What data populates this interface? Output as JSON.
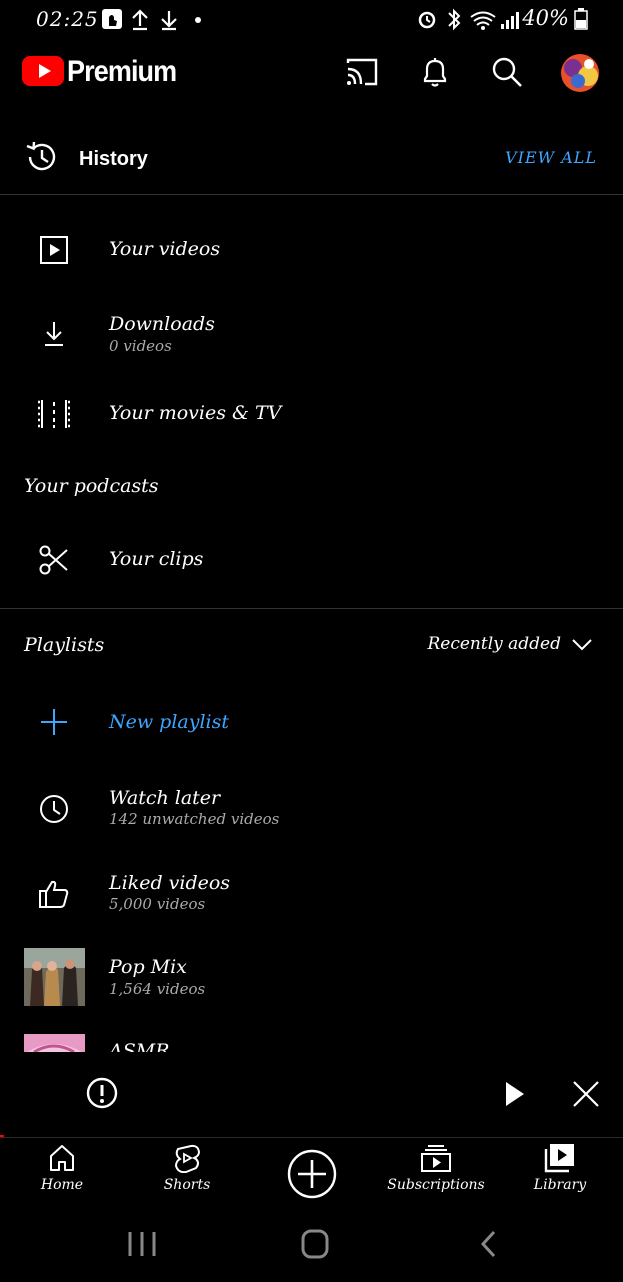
{
  "status_bar": {
    "time": "02:25",
    "battery": "40%"
  },
  "header": {
    "brand": "Premium",
    "brand_color": "#ff0000"
  },
  "history": {
    "title": "History",
    "view_all": "VIEW ALL"
  },
  "library_items": [
    {
      "label": "Your videos",
      "icon": "play-box-icon"
    },
    {
      "label": "Downloads",
      "sub": "0 videos",
      "icon": "download-icon"
    },
    {
      "label": "Your movies & TV",
      "icon": "film-icon"
    },
    {
      "label": "Your clips",
      "icon": "scissors-icon"
    }
  ],
  "podcasts": {
    "label": "Your podcasts"
  },
  "playlists": {
    "title": "Playlists",
    "sort_label": "Recently added",
    "new_playlist": "New playlist",
    "accent": "#3ea6ff",
    "items": [
      {
        "title": "Watch later",
        "sub": "142 unwatched videos",
        "icon": "clock-icon"
      },
      {
        "title": "Liked videos",
        "sub": "5,000 videos",
        "icon": "thumbs-up-icon"
      },
      {
        "title": "Pop Mix",
        "sub": "1,564 videos",
        "icon": "thumbnail"
      },
      {
        "title": "ASMR",
        "icon": "thumbnail"
      }
    ]
  },
  "bottom_nav": [
    {
      "label": "Home",
      "icon": "home-icon"
    },
    {
      "label": "Shorts",
      "icon": "shorts-icon"
    },
    {
      "label": "",
      "icon": "create-plus-icon"
    },
    {
      "label": "Subscriptions",
      "icon": "subscriptions-icon"
    },
    {
      "label": "Library",
      "icon": "library-icon"
    }
  ]
}
